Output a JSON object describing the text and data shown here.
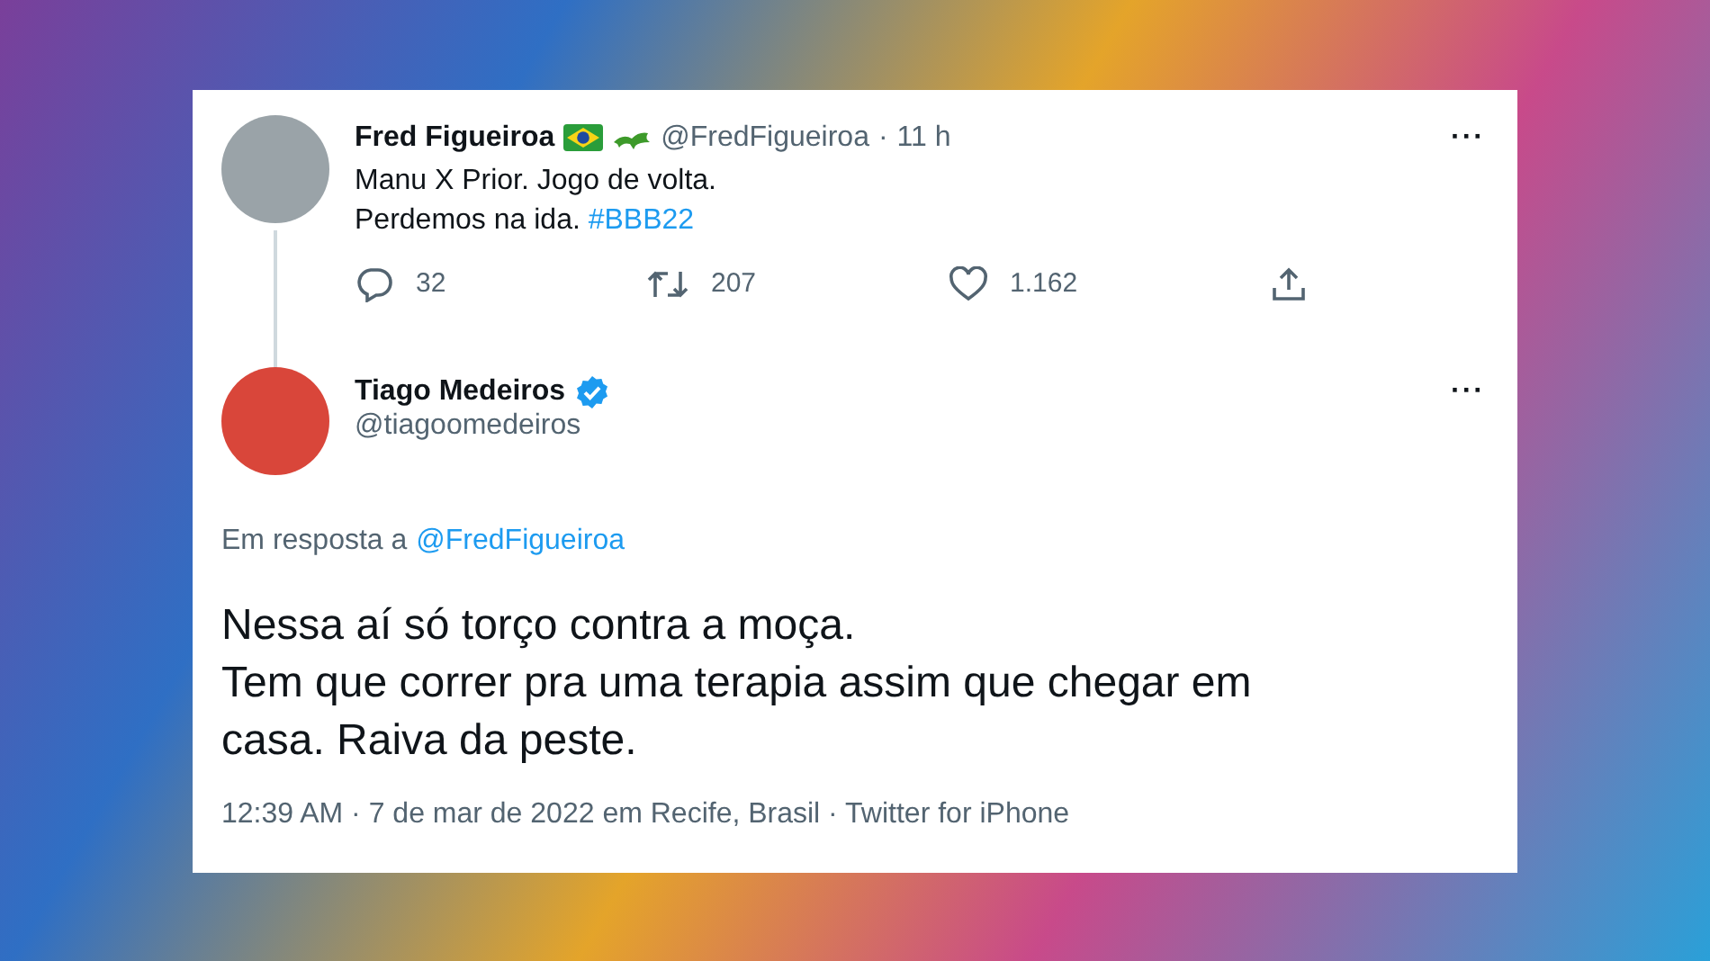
{
  "original_tweet": {
    "name": "Fred Figueiroa",
    "handle": "@FredFigueiroa",
    "separator": "·",
    "time": "11 h",
    "more": "···",
    "text": "Manu X Prior. Jogo de volta.\nPerdemos na ida. ",
    "hashtag": "#BBB22",
    "actions": [
      {
        "kind": "reply",
        "count": "32"
      },
      {
        "kind": "retweet",
        "count": "207"
      },
      {
        "kind": "like",
        "count": "1.162"
      },
      {
        "kind": "share"
      }
    ]
  },
  "reply_tweet": {
    "name": "Tiago Medeiros",
    "verified": true,
    "handle": "@tiagoomedeiros",
    "more": "···",
    "reply_to_label": "Em resposta a",
    "reply_to_handle": "@FredFigueiroa",
    "text": "Nessa aí só torço contra a moça.\nTem que correr pra uma terapia assim que chegar em\ncasa. Raiva da peste.",
    "meta": "12:39 AM · 7 de mar de 2022 em Recife, Brasil · Twitter for iPhone"
  }
}
